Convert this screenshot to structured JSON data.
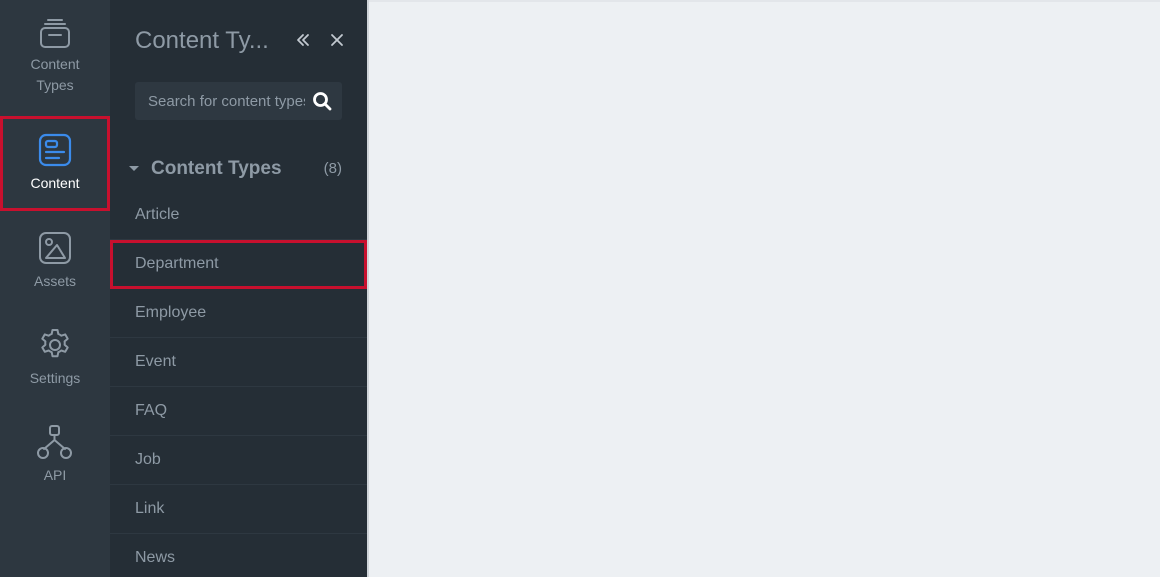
{
  "rail": {
    "items": [
      {
        "label": "Content\nTypes",
        "icon": "content-types-icon"
      },
      {
        "label": "Content",
        "icon": "content-icon"
      },
      {
        "label": "Assets",
        "icon": "assets-icon"
      },
      {
        "label": "Settings",
        "icon": "settings-icon"
      },
      {
        "label": "API",
        "icon": "api-icon"
      }
    ],
    "active_index": 1,
    "active_color": "#3b8beb"
  },
  "panel": {
    "title": "Content Ty...",
    "search": {
      "placeholder": "Search for content types"
    },
    "group": {
      "label": "Content Types",
      "count": "(8)"
    },
    "items": [
      {
        "label": "Article"
      },
      {
        "label": "Department"
      },
      {
        "label": "Employee"
      },
      {
        "label": "Event"
      },
      {
        "label": "FAQ"
      },
      {
        "label": "Job"
      },
      {
        "label": "Link"
      },
      {
        "label": "News"
      }
    ]
  },
  "colors": {
    "highlight": "#c8102e",
    "rail_bg": "#2d3740",
    "panel_bg": "#252e36",
    "main_bg": "#edf0f3"
  }
}
